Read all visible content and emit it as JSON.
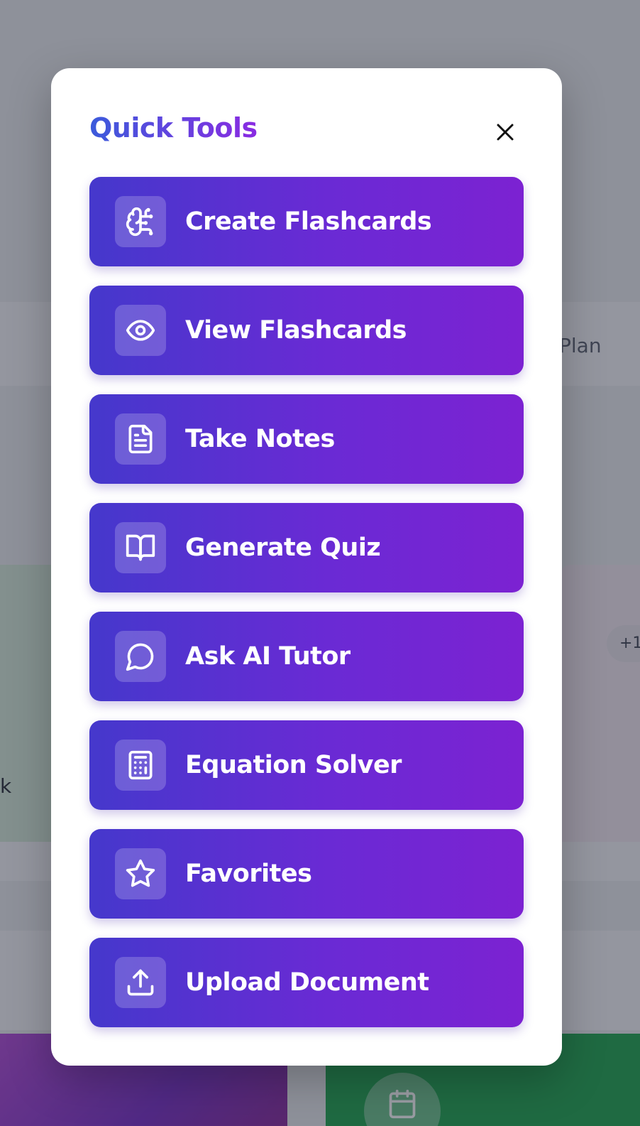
{
  "background": {
    "partial_text_right": "Plan",
    "partial_text_left": "k",
    "partial_badge": "+1"
  },
  "modal": {
    "title": "Quick Tools",
    "close_icon": "close-icon",
    "tools": [
      {
        "label": "Create Flashcards",
        "icon": "brain-icon"
      },
      {
        "label": "View Flashcards",
        "icon": "eye-icon"
      },
      {
        "label": "Take Notes",
        "icon": "file-text-icon"
      },
      {
        "label": "Generate Quiz",
        "icon": "book-open-icon"
      },
      {
        "label": "Ask AI Tutor",
        "icon": "message-circle-icon"
      },
      {
        "label": "Equation Solver",
        "icon": "calculator-icon"
      },
      {
        "label": "Favorites",
        "icon": "star-icon"
      },
      {
        "label": "Upload Document",
        "icon": "upload-icon"
      }
    ]
  },
  "colors": {
    "title_gradient_start": "#3b5bdb",
    "title_gradient_end": "#8a2be2",
    "button_gradient_start": "#4538cc",
    "button_gradient_end": "#7c22d2"
  }
}
